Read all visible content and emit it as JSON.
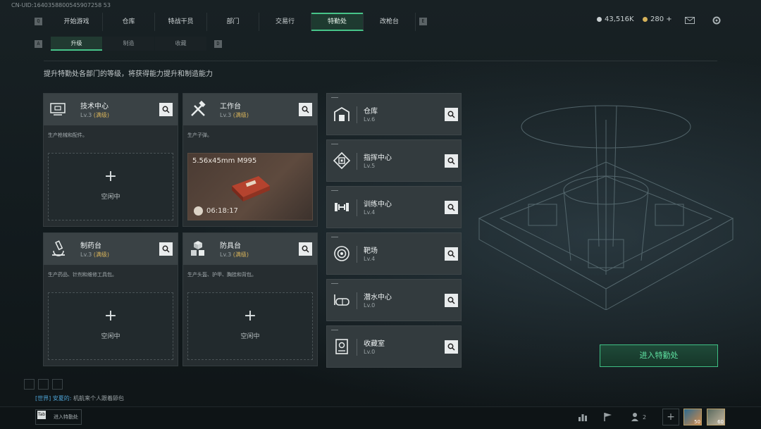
{
  "uid": "CN-UID:1640358800545907258 53",
  "nav": {
    "left_key": "Q",
    "right_key": "E",
    "tabs": [
      "开始游戏",
      "仓库",
      "特战干员",
      "部门",
      "交易行",
      "特勤处",
      "改枪台"
    ],
    "active": "特勤处"
  },
  "currency": {
    "coins": "43,516K",
    "tokens": "280 +"
  },
  "subnav": {
    "left_key": "A",
    "right_key": "D",
    "tabs": [
      "升级",
      "制造",
      "收藏"
    ],
    "active": "升级"
  },
  "description": "提升特勤处各部门的等级，将获得能力提升和制造能力",
  "departments": [
    {
      "name": "技术中心",
      "level": "Lv.3",
      "max": "(满级)",
      "produce": "生产枪械和配件。",
      "status": "idle",
      "icon": "computer-icon"
    },
    {
      "name": "工作台",
      "level": "Lv.3",
      "max": "(满级)",
      "produce": "生产子弹。",
      "status": "crafting",
      "item": "5.56x45mm M995",
      "timer": "06:18:17",
      "icon": "tools-icon"
    },
    {
      "name": "制药台",
      "level": "Lv.3",
      "max": "(满级)",
      "produce": "生产药品、针剂和维修工具包。",
      "status": "idle",
      "icon": "microscope-icon"
    },
    {
      "name": "防具台",
      "level": "Lv.3",
      "max": "(满级)",
      "produce": "生产头盔、护甲、胸挂和背包。",
      "status": "idle",
      "icon": "armor-cubes-icon"
    }
  ],
  "idle_text": "空闲中",
  "plus": "+",
  "facilities": [
    {
      "name": "仓库",
      "level": "Lv.6",
      "icon": "warehouse-icon"
    },
    {
      "name": "指挥中心",
      "level": "Lv.5",
      "icon": "command-chip-icon"
    },
    {
      "name": "训练中心",
      "level": "Lv.4",
      "icon": "dumbbell-icon"
    },
    {
      "name": "靶场",
      "level": "Lv.4",
      "icon": "target-icon"
    },
    {
      "name": "潜水中心",
      "level": "Lv.0",
      "icon": "diving-mask-icon"
    },
    {
      "name": "收藏室",
      "level": "Lv.0",
      "icon": "collection-icon"
    }
  ],
  "enter_button": "进入特勤处",
  "chat": {
    "channel": "[世界]",
    "sender": "安夏的:",
    "message": "机航来个人跟着舔包"
  },
  "bottom": {
    "tab_key": "Tab",
    "tab_label": "进入特勤处",
    "friends_count": "2",
    "avatar1_level": "50",
    "avatar2_level": "60"
  },
  "colors": {
    "accent": "#47c489",
    "max_level": "#d6b25a",
    "chat_channel": "#4ea4d6"
  }
}
